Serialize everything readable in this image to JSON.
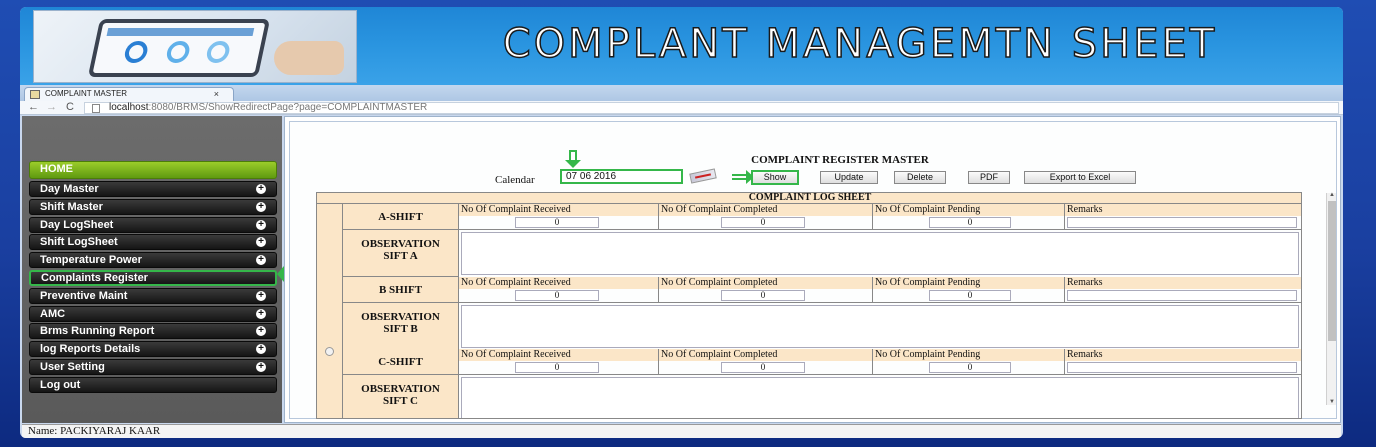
{
  "banner": {
    "title": "COMPLANT MANAGEMTN  SHEET"
  },
  "browser": {
    "tab_title": "COMPLAINT MASTER",
    "tab_close": "×",
    "url_host": "localhost",
    "url_path": ":8080/BRMS/ShowRedirectPage?page=COMPLAINTMASTER",
    "back": "←",
    "forward": "→",
    "reload": "C"
  },
  "sidebar": {
    "items": [
      {
        "label": "HOME"
      },
      {
        "label": "Day Master"
      },
      {
        "label": "Shift Master"
      },
      {
        "label": "Day LogSheet"
      },
      {
        "label": "Shift LogSheet"
      },
      {
        "label": "Temperature Power"
      },
      {
        "label": "Complaints Register"
      },
      {
        "label": "Preventive Maint"
      },
      {
        "label": "AMC"
      },
      {
        "label": "Brms Running Report"
      },
      {
        "label": "log Reports Details"
      },
      {
        "label": "User Setting"
      },
      {
        "label": "Log out"
      }
    ],
    "plus": "+"
  },
  "footer": {
    "user": "Name: PACKIYARAJ KAAR"
  },
  "form": {
    "title": "COMPLAINT REGISTER MASTER",
    "calendar_label": "Calendar",
    "date": "07 06 2016",
    "buttons": {
      "show": "Show",
      "update": "Update",
      "delete": "Delete",
      "pdf": "PDF",
      "excel": "Export to Excel"
    }
  },
  "log": {
    "title": "COMPLAINT LOG SHEET",
    "headers": {
      "received": "No Of Complaint Received",
      "completed": "No Of Complaint Completed",
      "pending": "No Of Complaint Pending",
      "remarks": "Remarks"
    },
    "shifts": [
      {
        "label": "A-SHIFT",
        "received": "0",
        "completed": "0",
        "pending": "0",
        "remarks": "",
        "obs_line1": "OBSERVATION",
        "obs_line2": "SIFT A"
      },
      {
        "label": "B SHIFT",
        "received": "0",
        "completed": "0",
        "pending": "0",
        "remarks": "",
        "obs_line1": "OBSERVATION",
        "obs_line2": "SIFT B"
      },
      {
        "label": "C-SHIFT",
        "received": "0",
        "completed": "0",
        "pending": "0",
        "remarks": "",
        "obs_line1": "OBSERVATION",
        "obs_line2": "SIFT C"
      }
    ]
  },
  "colors": {
    "highlight_green": "#35b74a",
    "home_green": "#7db51c",
    "header_peach": "#fbe6c8"
  }
}
